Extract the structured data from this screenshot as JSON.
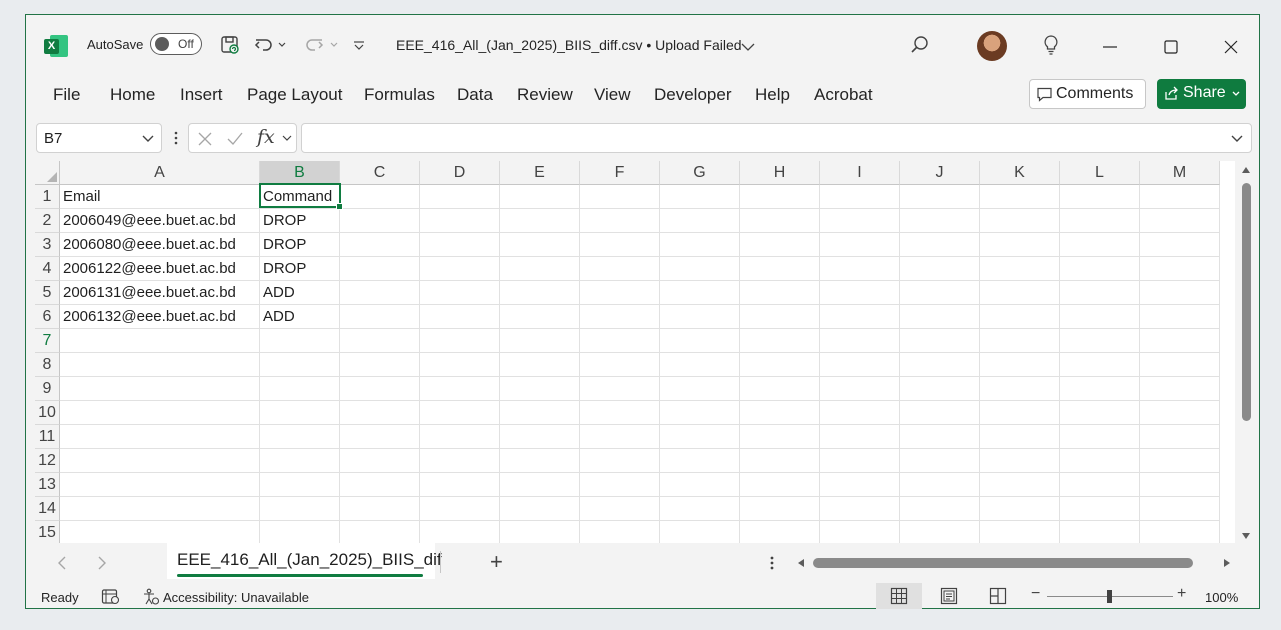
{
  "titlebar": {
    "autosave_label": "AutoSave",
    "autosave_state": "Off",
    "document_title": "EEE_416_All_(Jan_2025)_BIIS_diff.csv • Upload Failed",
    "logo_letter": "X"
  },
  "menu": {
    "items": [
      "File",
      "Home",
      "Insert",
      "Page Layout",
      "Formulas",
      "Data",
      "Review",
      "View",
      "Developer",
      "Help",
      "Acrobat"
    ],
    "comments_label": "Comments",
    "share_label": "Share"
  },
  "formula_bar": {
    "name_box": "B7",
    "fx_label": "fx",
    "formula_value": ""
  },
  "sheet": {
    "columns": [
      "A",
      "B",
      "C",
      "D",
      "E",
      "F",
      "G",
      "H",
      "I",
      "J",
      "K",
      "L",
      "M"
    ],
    "selected_column": "B",
    "selected_row": 7,
    "row_numbers": [
      "1",
      "2",
      "3",
      "4",
      "5",
      "6",
      "7",
      "8",
      "9",
      "10",
      "11",
      "12",
      "13",
      "14",
      "15"
    ],
    "rows": [
      [
        "Email",
        "Command"
      ],
      [
        "2006049@eee.buet.ac.bd",
        "DROP"
      ],
      [
        "2006080@eee.buet.ac.bd",
        "DROP"
      ],
      [
        "2006122@eee.buet.ac.bd",
        "DROP"
      ],
      [
        "2006131@eee.buet.ac.bd",
        "ADD"
      ],
      [
        "2006132@eee.buet.ac.bd",
        "ADD"
      ]
    ]
  },
  "tabs": {
    "active_sheet": "EEE_416_All_(Jan_2025)_BIIS_dif",
    "add_sheet": "+"
  },
  "status": {
    "ready": "Ready",
    "accessibility": "Accessibility: Unavailable",
    "zoom": "100%",
    "zoom_minus": "−",
    "zoom_plus": "+"
  },
  "colors": {
    "accent": "#107c41",
    "share_bg": "#0f7b3f"
  }
}
